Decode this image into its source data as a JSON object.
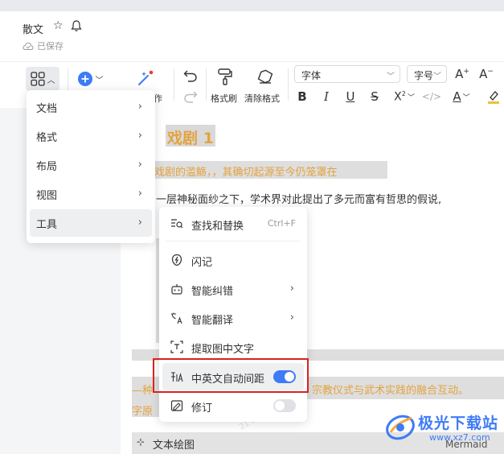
{
  "header": {
    "doc_title": "散文",
    "saved_status": "已保存"
  },
  "toolbar": {
    "format_painter": "格式刷",
    "clear_format": "清除格式",
    "font_select": "字体",
    "size_select": "字号",
    "partial_label": "作"
  },
  "main_menu": {
    "items": [
      {
        "label": "文档"
      },
      {
        "label": "格式"
      },
      {
        "label": "布局"
      },
      {
        "label": "视图"
      },
      {
        "label": "工具"
      }
    ]
  },
  "tools_submenu": {
    "items": [
      {
        "label": "查找和替换",
        "shortcut": "Ctrl+F"
      },
      {
        "label": "闪记"
      },
      {
        "label": "智能纠错"
      },
      {
        "label": "智能翻译"
      },
      {
        "label": "提取图中文字"
      },
      {
        "label": "中英文自动间距",
        "toggle": true
      },
      {
        "label": "修订",
        "toggle": false
      }
    ]
  },
  "document": {
    "heading": "戏剧 1",
    "line1": "戏剧的滥觞，，其确切起源至今仍笼罩在",
    "line2": "一层神秘面纱之下，学术界对此提出了多元而富有哲思的假说,",
    "line3_prefix": "—种",
    "line3": "宗教仪式与武术实践的融合互动。",
    "line4": "字原",
    "textdraw_label": "文本绘图",
    "mermaid_label": "Mermaid"
  },
  "watermark_text": "21 5896",
  "brand": {
    "name": "极光下载站",
    "url": "www.xz7.com"
  },
  "colors": {
    "accent": "#3d7bf7",
    "orange": "#e3a33f",
    "highlight_red": "#d9231e"
  }
}
